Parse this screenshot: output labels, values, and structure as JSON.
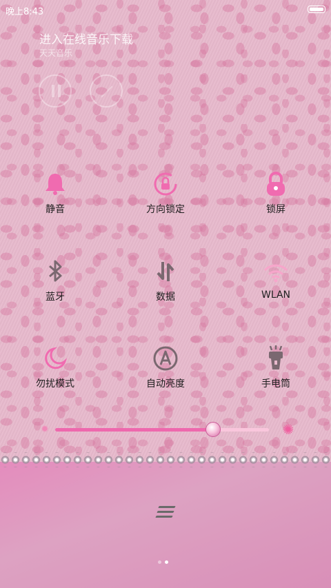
{
  "status_bar": {
    "time": "晚上8:43"
  },
  "music": {
    "title": "进入在线音乐下载",
    "subtitle": "天天音乐"
  },
  "tiles": [
    {
      "label": "静音",
      "icon": "bell-icon"
    },
    {
      "label": "方向锁定",
      "icon": "rotation-lock-icon"
    },
    {
      "label": "锁屏",
      "icon": "lock-icon"
    },
    {
      "label": "蓝牙",
      "icon": "bluetooth-icon"
    },
    {
      "label": "数据",
      "icon": "mobile-data-icon"
    },
    {
      "label": "WLAN",
      "icon": "wifi-icon"
    },
    {
      "label": "勿扰模式",
      "icon": "moon-icon"
    },
    {
      "label": "自动亮度",
      "icon": "auto-brightness-icon"
    },
    {
      "label": "手电筒",
      "icon": "flashlight-icon"
    }
  ],
  "brightness": {
    "level": 0.74
  },
  "pager": {
    "current": 2,
    "total": 2
  },
  "colors": {
    "accent": "#ee68ad",
    "icon_pink": "#f06bb0",
    "icon_gray": "#7a6870"
  }
}
